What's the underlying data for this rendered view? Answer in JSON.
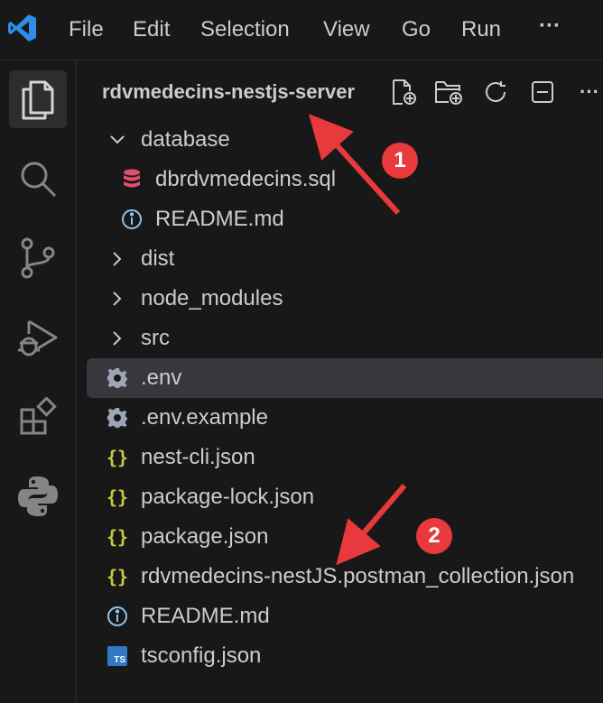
{
  "menu": {
    "items": [
      "File",
      "Edit",
      "Selection",
      "View",
      "Go",
      "Run"
    ],
    "more": "···"
  },
  "activity_bar": {
    "icons": [
      "files-icon",
      "search-icon",
      "source-control-icon",
      "run-debug-icon",
      "extensions-icon",
      "python-icon"
    ]
  },
  "explorer": {
    "title": "rdvmedecins-nestjs-server",
    "actions": [
      "new-file-icon",
      "new-folder-icon",
      "refresh-icon",
      "collapse-all-icon",
      "more-icon"
    ],
    "more_label": "···",
    "tree": [
      {
        "label": "database",
        "kind": "folder-open"
      },
      {
        "label": "dbrdvmedecins.sql",
        "kind": "sql"
      },
      {
        "label": "README.md",
        "kind": "info"
      },
      {
        "label": "dist",
        "kind": "folder"
      },
      {
        "label": "node_modules",
        "kind": "folder"
      },
      {
        "label": "src",
        "kind": "folder"
      },
      {
        "label": ".env",
        "kind": "gear",
        "selected": true
      },
      {
        "label": ".env.example",
        "kind": "gear"
      },
      {
        "label": "nest-cli.json",
        "kind": "json"
      },
      {
        "label": "package-lock.json",
        "kind": "json"
      },
      {
        "label": "package.json",
        "kind": "json"
      },
      {
        "label": "rdvmedecins-nestJS.postman_collection.json",
        "kind": "json"
      },
      {
        "label": "README.md",
        "kind": "info"
      },
      {
        "label": "tsconfig.json",
        "kind": "ts"
      }
    ],
    "json_glyph": "{}",
    "ts_glyph": "TS"
  },
  "annotations": {
    "badge1": "1",
    "badge2": "2",
    "color": "#e8393c"
  }
}
